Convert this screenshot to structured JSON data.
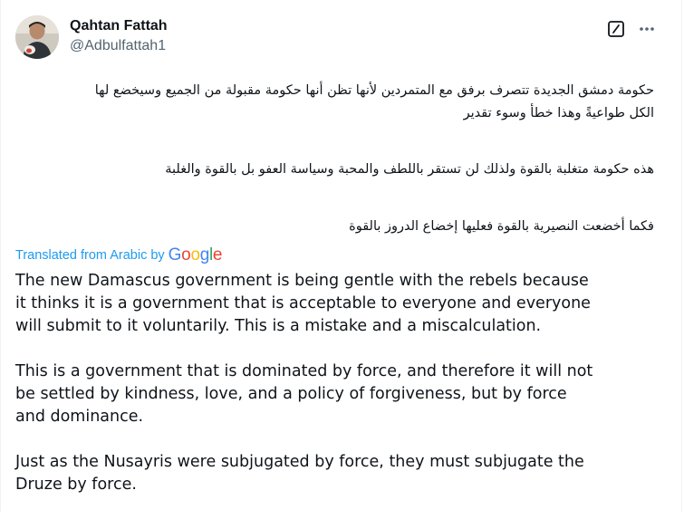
{
  "author": {
    "display_name": "Qahtan Fattah",
    "handle": "@Adbulfattah1",
    "avatar_icon": "profile-photo"
  },
  "actions": {
    "grok_icon": "grok-icon",
    "more_icon": "more-options-icon"
  },
  "original_text": {
    "paragraphs": [
      [
        "حكومة دمشق الجديدة تتصرف برفق مع المتمردين لأنها تظن أنها حكومة مقبولة من الجميع وسيخضع لها",
        "الكل طواعيةً وهذا خطأ وسوء تقدير"
      ],
      [
        "هذه حكومة متغلبة بالقوة ولذلك لن تستقر باللطف والمحبة وسياسة العفو بل بالقوة والغلبة"
      ],
      [
        "فكما أخضعت النصيرية بالقوة فعليها إخضاع الدروز بالقوة"
      ]
    ]
  },
  "translation": {
    "label_prefix": "Translated from Arabic by",
    "provider": "Google",
    "provider_colors": [
      "#4285F4",
      "#EA4335",
      "#FBBC05",
      "#4285F4",
      "#34A853",
      "#EA4335"
    ],
    "paragraphs": [
      [
        "The new Damascus government is being gentle with the rebels because",
        "it thinks it is a government that is acceptable to everyone and everyone",
        "will submit to it voluntarily. This is a mistake and a miscalculation."
      ],
      [
        "This is a government that is dominated by force, and therefore it will not",
        "be settled by kindness, love, and a policy of forgiveness, but by force",
        "and dominance."
      ],
      [
        "Just as the Nusayris were subjugated by force, they must subjugate the",
        "Druze by force."
      ]
    ]
  },
  "colors": {
    "link": "#1d9bf0",
    "secondary_text": "#536471",
    "primary_text": "#0f1419"
  }
}
